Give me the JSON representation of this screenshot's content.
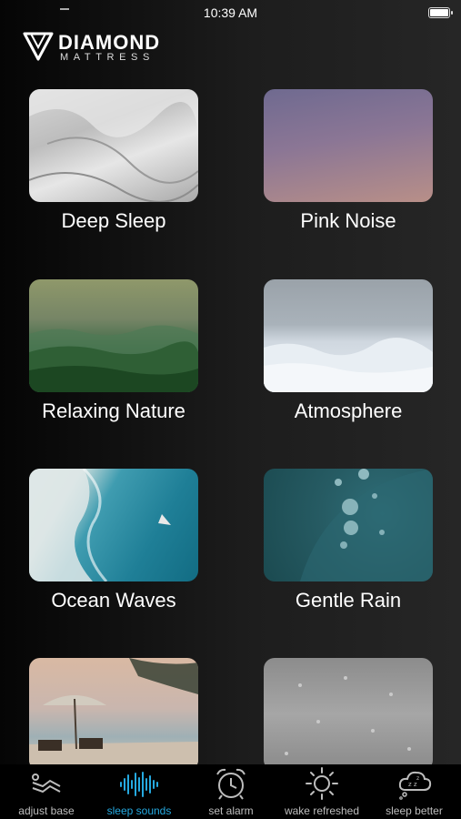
{
  "status_bar": {
    "time": "10:39 AM"
  },
  "brand": {
    "name": "DIAMOND",
    "subtitle": "MATTRESS"
  },
  "sounds": [
    {
      "label": "Deep Sleep"
    },
    {
      "label": "Pink Noise"
    },
    {
      "label": "Relaxing Nature"
    },
    {
      "label": "Atmosphere"
    },
    {
      "label": "Ocean Waves"
    },
    {
      "label": "Gentle Rain"
    },
    {
      "label": ""
    },
    {
      "label": ""
    }
  ],
  "tabs": [
    {
      "label": "adjust base",
      "icon": "adjustable-bed-icon",
      "active": false
    },
    {
      "label": "sleep sounds",
      "icon": "sound-wave-icon",
      "active": true
    },
    {
      "label": "set alarm",
      "icon": "alarm-clock-icon",
      "active": false
    },
    {
      "label": "wake refreshed",
      "icon": "sun-icon",
      "active": false
    },
    {
      "label": "sleep better",
      "icon": "zzz-cloud-icon",
      "active": false
    }
  ],
  "colors": {
    "accent": "#25a9e0",
    "tab_inactive": "#bdbdbd",
    "tabbar_bg": "#000000"
  }
}
